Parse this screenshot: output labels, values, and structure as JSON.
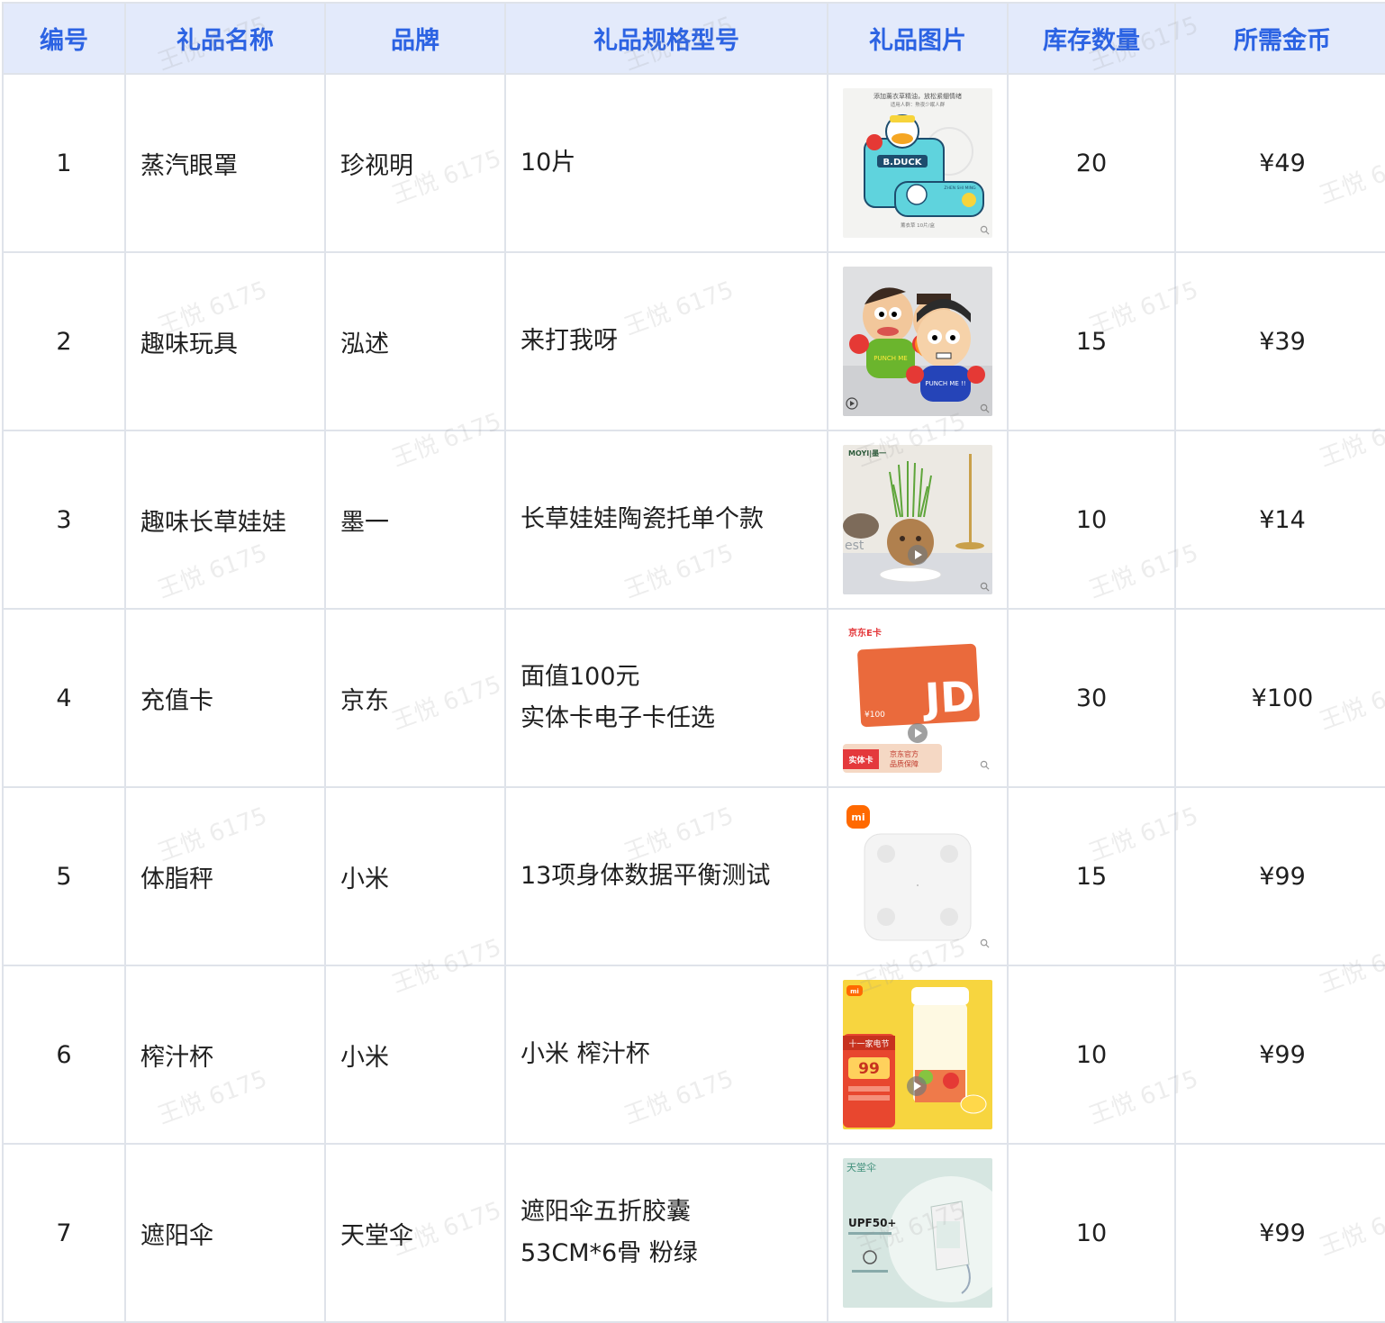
{
  "headers": {
    "id": "编号",
    "name": "礼品名称",
    "brand": "品牌",
    "spec": "礼品规格型号",
    "image": "礼品图片",
    "stock": "库存数量",
    "coins": "所需金币"
  },
  "rows": [
    {
      "id": "1",
      "name": "蒸汽眼罩",
      "brand": "珍视明",
      "spec": [
        "10片"
      ],
      "stock": "20",
      "coins": "¥49",
      "image": {
        "icon": "steam-eye-mask-image",
        "texts": [
          "添加薰衣草精油，放松紧绷情绪",
          "适用人群：熬夜少眠人群",
          "B.DUCK",
          "ZHEN SHI MING",
          "薰衣草 10片/盒"
        ]
      }
    },
    {
      "id": "2",
      "name": "趣味玩具",
      "brand": "泓述",
      "spec": [
        "来打我呀"
      ],
      "stock": "15",
      "coins": "¥39",
      "image": {
        "icon": "punch-me-toy-image",
        "texts": [
          "PUNCH ME",
          "PUNCH ME !!"
        ]
      }
    },
    {
      "id": "3",
      "name": "趣味长草娃娃",
      "brand": "墨一",
      "spec": [
        "长草娃娃陶瓷托单个款"
      ],
      "stock": "10",
      "coins": "¥14",
      "image": {
        "icon": "grass-doll-image",
        "texts": [
          "MOYI|墨一",
          "est"
        ]
      }
    },
    {
      "id": "4",
      "name": "充值卡",
      "brand": "京东",
      "spec": [
        "面值100元",
        "实体卡电子卡任选"
      ],
      "stock": "30",
      "coins": "¥100",
      "image": {
        "icon": "jd-gift-card-image",
        "texts": [
          "京东E卡",
          "¥100",
          "JD",
          "实体卡",
          "京东官方",
          "品质保障"
        ]
      }
    },
    {
      "id": "5",
      "name": "体脂秤",
      "brand": "小米",
      "spec": [
        "13项身体数据平衡测试"
      ],
      "stock": "15",
      "coins": "¥99",
      "image": {
        "icon": "body-fat-scale-image",
        "texts": [
          "mi"
        ]
      }
    },
    {
      "id": "6",
      "name": "榨汁杯",
      "brand": "小米",
      "spec": [
        "小米 榨汁杯"
      ],
      "stock": "10",
      "coins": "¥99",
      "image": {
        "icon": "juicer-cup-image",
        "texts": [
          "mi",
          "十一家电节",
          "99"
        ]
      }
    },
    {
      "id": "7",
      "name": "遮阳伞",
      "brand": "天堂伞",
      "spec": [
        "遮阳伞五折胶囊",
        "53CM*6骨 粉绿"
      ],
      "stock": "10",
      "coins": "¥99",
      "image": {
        "icon": "sun-umbrella-image",
        "texts": [
          "天堂伞",
          "UPF50+"
        ]
      }
    }
  ],
  "watermark": "王悦 6175",
  "colors": {
    "header_bg": "#e3eafb",
    "header_text": "#2c63e3",
    "grid_line": "#dfe3ea"
  }
}
